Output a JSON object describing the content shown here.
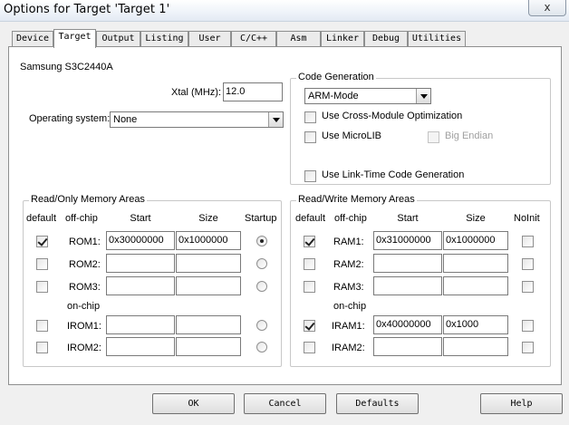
{
  "window": {
    "title": "Options for Target 'Target 1'",
    "close_glyph": "x"
  },
  "tabs": [
    {
      "label": "Device"
    },
    {
      "label": "Target"
    },
    {
      "label": "Output"
    },
    {
      "label": "Listing"
    },
    {
      "label": "User"
    },
    {
      "label": "C/C++"
    },
    {
      "label": "Asm"
    },
    {
      "label": "Linker"
    },
    {
      "label": "Debug"
    },
    {
      "label": "Utilities"
    }
  ],
  "active_tab": "Target",
  "device_name": "Samsung S3C2440A",
  "xtal": {
    "label": "Xtal (MHz):",
    "value": "12.0"
  },
  "operating_system": {
    "label": "Operating system:",
    "value": "None"
  },
  "code_generation": {
    "title": "Code Generation",
    "mode": "ARM-Mode",
    "cross_module": {
      "label": "Use Cross-Module Optimization",
      "checked": false
    },
    "microlib": {
      "label": "Use MicroLIB",
      "checked": false
    },
    "big_endian": {
      "label": "Big Endian",
      "checked": false,
      "enabled": false
    },
    "link_time": {
      "label": "Use Link-Time Code Generation",
      "checked": false
    }
  },
  "ro_memory": {
    "title": "Read/Only Memory Areas",
    "headers": {
      "default": "default",
      "offchip": "off-chip",
      "start": "Start",
      "size": "Size",
      "startup": "Startup"
    },
    "onchip_label": "on-chip",
    "rows": [
      {
        "name": "ROM1:",
        "default": true,
        "start": "0x30000000",
        "size": "0x1000000",
        "startup": true
      },
      {
        "name": "ROM2:",
        "default": false,
        "start": "",
        "size": "",
        "startup": false
      },
      {
        "name": "ROM3:",
        "default": false,
        "start": "",
        "size": "",
        "startup": false
      },
      {
        "name": "IROM1:",
        "default": false,
        "start": "",
        "size": "",
        "startup": false
      },
      {
        "name": "IROM2:",
        "default": false,
        "start": "",
        "size": "",
        "startup": false
      }
    ]
  },
  "rw_memory": {
    "title": "Read/Write Memory Areas",
    "headers": {
      "default": "default",
      "offchip": "off-chip",
      "start": "Start",
      "size": "Size",
      "noinit": "NoInit"
    },
    "onchip_label": "on-chip",
    "rows": [
      {
        "name": "RAM1:",
        "default": true,
        "start": "0x31000000",
        "size": "0x1000000",
        "noinit": false
      },
      {
        "name": "RAM2:",
        "default": false,
        "start": "",
        "size": "",
        "noinit": false
      },
      {
        "name": "RAM3:",
        "default": false,
        "start": "",
        "size": "",
        "noinit": false
      },
      {
        "name": "IRAM1:",
        "default": true,
        "start": "0x40000000",
        "size": "0x1000",
        "noinit": false
      },
      {
        "name": "IRAM2:",
        "default": false,
        "start": "",
        "size": "",
        "noinit": false
      }
    ]
  },
  "buttons": {
    "ok": "OK",
    "cancel": "Cancel",
    "defaults": "Defaults",
    "help": "Help"
  }
}
